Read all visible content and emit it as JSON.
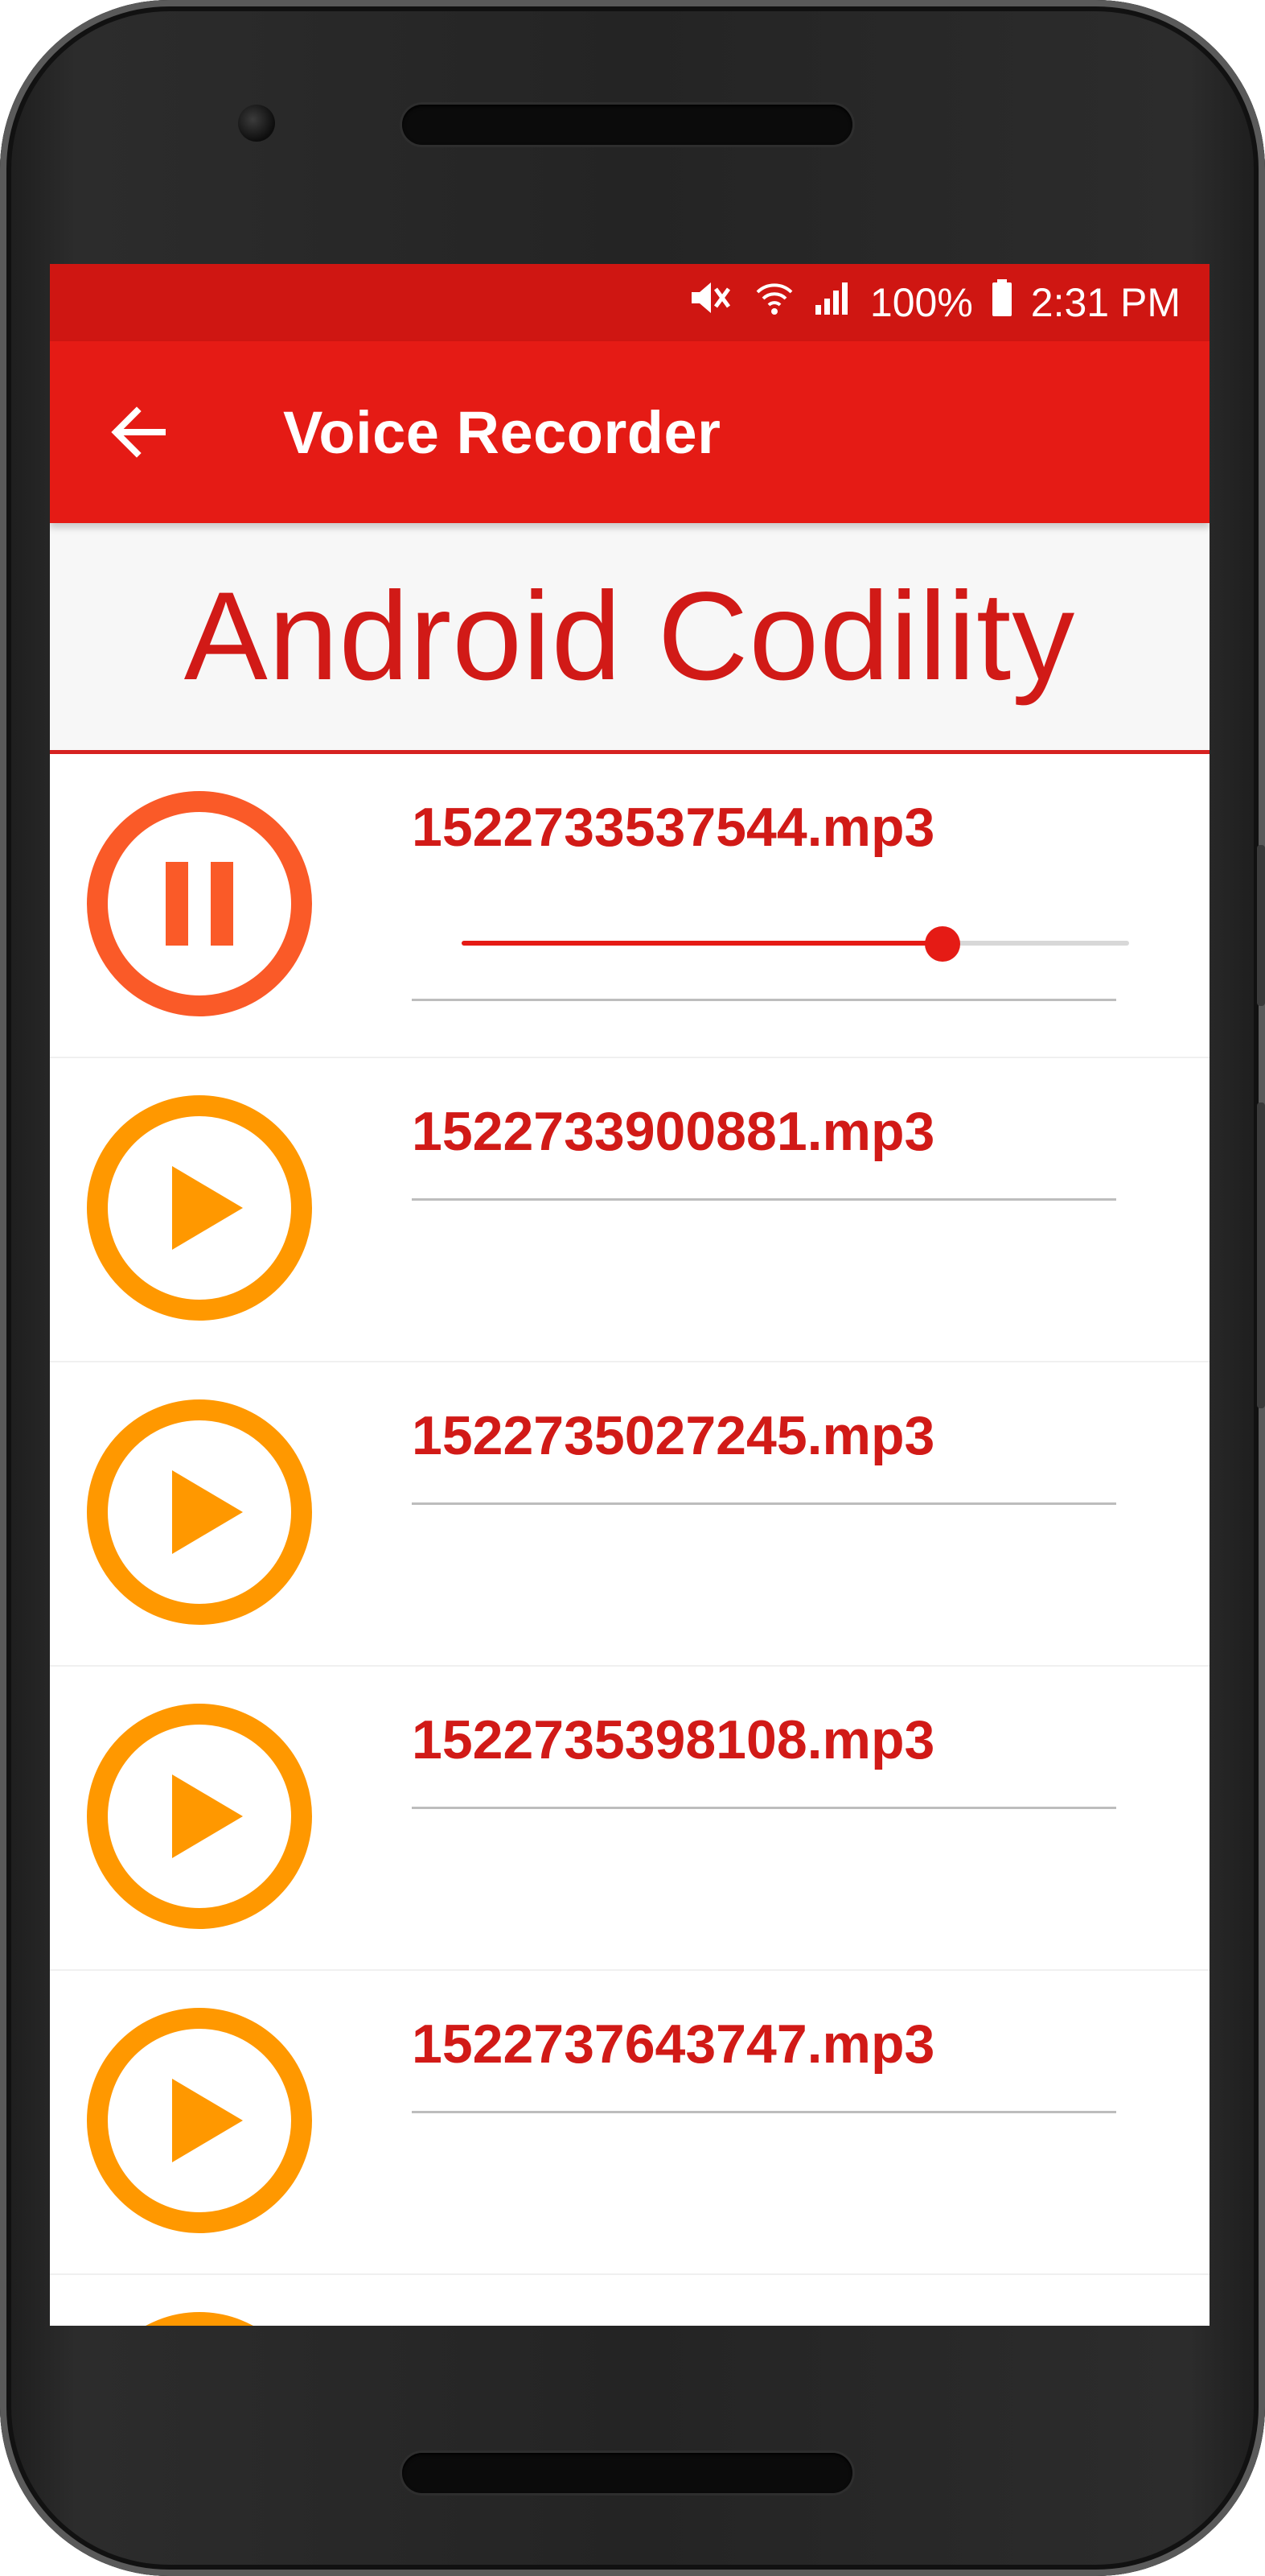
{
  "status_bar": {
    "battery_text": "100%",
    "time": "2:31 PM",
    "icons": [
      "mute-icon",
      "wifi-icon",
      "signal-icon",
      "battery-icon"
    ]
  },
  "app_bar": {
    "title": "Voice Recorder",
    "back_icon": "arrow-left-icon"
  },
  "banner": {
    "text": "Android Codility"
  },
  "colors": {
    "primary": "#e51b15",
    "primary_dark": "#cf1612",
    "text_red": "#d11a17",
    "pause_orange": "#fa5a28",
    "play_orange": "#ff9800"
  },
  "recordings": [
    {
      "name": "1522733537544.mp3",
      "state": "playing",
      "icon": "pause-icon",
      "progress": 0.72
    },
    {
      "name": "1522733900881.mp3",
      "state": "stopped",
      "icon": "play-icon"
    },
    {
      "name": "1522735027245.mp3",
      "state": "stopped",
      "icon": "play-icon"
    },
    {
      "name": "1522735398108.mp3",
      "state": "stopped",
      "icon": "play-icon"
    },
    {
      "name": "1522737643747.mp3",
      "state": "stopped",
      "icon": "play-icon"
    }
  ]
}
